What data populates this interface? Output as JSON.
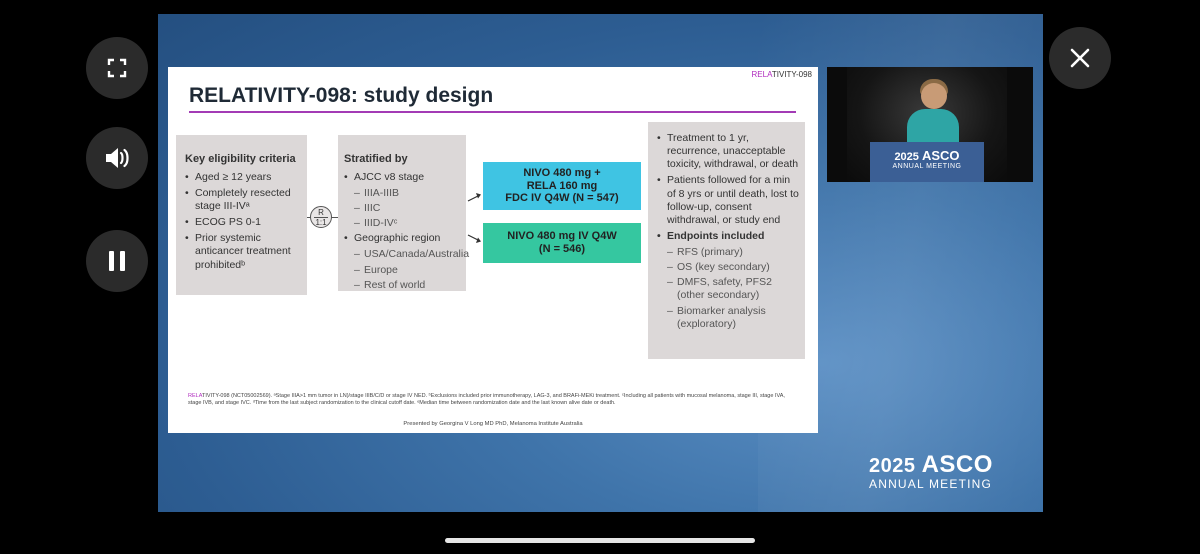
{
  "controls": {
    "fullscreen_icon": "fullscreen-icon",
    "volume_icon": "speaker-icon",
    "pause_icon": "pause-icon",
    "close_icon": "close-icon"
  },
  "slide": {
    "brand_prefix": "RELA",
    "brand_suffix": "TIVITY-098",
    "title": "RELATIVITY-098: study design",
    "eligibility": {
      "heading": "Key eligibility criteria",
      "items": [
        "Aged ≥ 12 years",
        "Completely resected stage III-IVᵃ",
        "ECOG PS 0-1",
        "Prior systemic anticancer treatment prohibitedᵇ"
      ]
    },
    "randomization": {
      "top": "R",
      "bottom": "1:1"
    },
    "stratification": {
      "heading": "Stratified by",
      "item1": "AJCC v8 stage",
      "item1_subs": [
        "IIIA-IIIB",
        "IIIC",
        "IIID-IVᶜ"
      ],
      "item2": "Geographic region",
      "item2_subs": [
        "USA/Canada/Australia",
        "Europe",
        "Rest of world"
      ]
    },
    "arm1": {
      "line1": "NIVO 480 mg +",
      "line2": "RELA 160 mg",
      "line3": "FDC IV Q4W (N = 547)"
    },
    "arm2": {
      "line1": "NIVO 480 mg IV Q4W",
      "line2": "(N = 546)"
    },
    "treatment": {
      "item1": "Treatment to 1 yr, recurrence, unacceptable toxicity, withdrawal, or death",
      "item2": "Patients followed for a min of 8 yrs or until death, lost to follow-up, consent withdrawal, or study end",
      "endpoints_heading": "Endpoints included",
      "endpoints": [
        "RFS (primary)",
        "OS (key secondary)",
        "DMFS, safety, PFS2 (other secondary)",
        "Biomarker analysis (exploratory)"
      ]
    },
    "footnote_prefix": "RELA",
    "footnote_text": "TIVITY-098 (NCT05002569). ᵃStage IIIA>1 mm tumor in LN)/stage IIIB/C/D or stage IV NED. ᵇExclusions included prior immunotherapy, LAG-3, and BRAFi-MEKi treatment. ᶜIncluding all patients with mucosal melanoma, stage III, stage IVA, stage IVB, and stage IVC. ᵈTime from the last subject randomization to the clinical cutoff date. ᵉMedian time between randomization date and the last known alive date or death.",
    "presenter": "Presented by Georgina V Long MD PhD, Melanoma Institute Australia"
  },
  "inset": {
    "year": "2025",
    "brand": "ASCO",
    "subtitle": "ANNUAL MEETING"
  },
  "logo": {
    "year": "2025",
    "brand": "ASCO",
    "subtitle": "ANNUAL MEETING"
  }
}
